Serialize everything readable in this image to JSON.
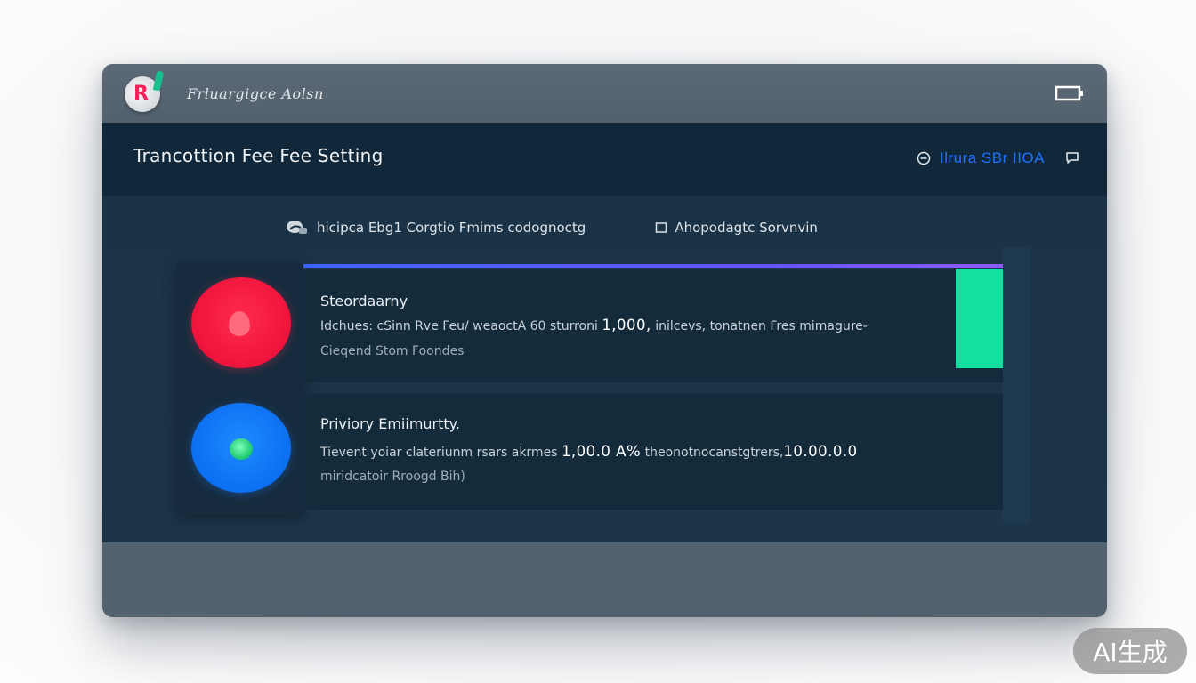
{
  "window": {
    "app_name": "Frluargigce Aolsn",
    "icons": {
      "logo": "app-logo-icon",
      "battery": "battery-icon"
    }
  },
  "header": {
    "title": "Trancottion Fee Fee Setting",
    "status_text": "Ilrura SBr IIOA",
    "icons": {
      "status": "circle-minus-icon",
      "action": "chat-icon"
    }
  },
  "filters": {
    "left_label": "hicipca Ebg1 Corgtio Fmims codognoctg",
    "right_label": "Ahopodagtc Sorvnvin",
    "icons": {
      "left": "badge-icon",
      "right": "square-icon"
    }
  },
  "tiers": [
    {
      "name": "Steordaarny",
      "desc_prefix": "Idchues: cSinn Rve Feu/ weaoctA 60 sturroni ",
      "amount": "1,000,",
      "desc_suffix": " inilcevs, tonatnen Fres mimagure-",
      "sub": "Cieqend Stom Foondes",
      "color": "#ec1038",
      "icon": "red-drop-icon"
    },
    {
      "name": "Priviory Emiimurtty.",
      "desc_prefix": "Tievent yoiar clateriunm rsars akrmes ",
      "amount": "1,00.0 A%",
      "desc_middle": " theonotnocanstgtrers,",
      "amount2": "10.00.0.0",
      "sub": "miridcatoir Rroogd Bih)",
      "color": "#0a6aef",
      "icon": "blue-orb-icon"
    }
  ],
  "badge": {
    "label": "AI生成"
  },
  "colors": {
    "accent_green": "#14e0a0",
    "accent_blue": "#1e73ff",
    "header_bg": "#10283a"
  }
}
